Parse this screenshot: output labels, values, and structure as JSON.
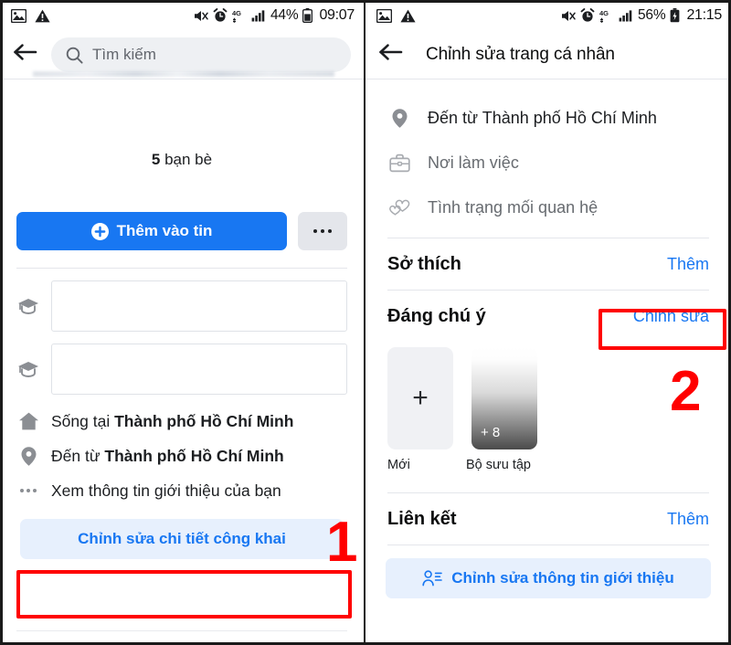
{
  "left_panel": {
    "statusbar": {
      "icons_left": [
        "image-icon",
        "warning-triangle-icon"
      ],
      "icons_right": [
        "mute-icon",
        "alarm-icon",
        "network-4g-icon",
        "signal-bars-icon"
      ],
      "network_label": "4G",
      "battery_pct": "44%",
      "clock": "09:07"
    },
    "topbar": {
      "back_icon": "back-arrow-icon",
      "search_icon": "search-icon",
      "search_placeholder": "Tìm kiếm",
      "search_value": ""
    },
    "friends": {
      "count": "5",
      "label": " bạn bè"
    },
    "actions": {
      "add_story_label": "Thêm vào tin",
      "add_story_icon": "plus-circle-icon",
      "more_icon": "more-horizontal-icon"
    },
    "fields": [
      {
        "icon": "graduation-cap-icon",
        "value": ""
      },
      {
        "icon": "graduation-cap-icon",
        "value": ""
      }
    ],
    "info_rows": [
      {
        "icon": "home-icon",
        "prefix": "Sống tại ",
        "bold": "Thành phố Hồ Chí Minh"
      },
      {
        "icon": "location-pin-icon",
        "prefix": "Đến từ ",
        "bold": "Thành phố Hồ Chí Minh"
      },
      {
        "icon": "more-horizontal-icon",
        "prefix": "Xem thông tin giới thiệu của bạn",
        "bold": ""
      }
    ],
    "edit_public_details_label": "Chỉnh sửa chi tiết công khai",
    "annotation": "1"
  },
  "right_panel": {
    "statusbar": {
      "icons_left": [
        "image-icon",
        "warning-triangle-icon"
      ],
      "icons_right": [
        "mute-icon",
        "alarm-icon",
        "network-4g-icon",
        "signal-bars-icon"
      ],
      "network_label": "4G",
      "battery_pct": "56%",
      "clock": "21:15"
    },
    "topbar": {
      "back_icon": "back-arrow-icon",
      "title": "Chỉnh sửa trang cá nhân"
    },
    "info_rows": [
      {
        "icon": "location-pin-icon",
        "text": "Đến từ Thành phố Hồ Chí Minh",
        "muted": false
      },
      {
        "icon": "briefcase-icon",
        "text": "Nơi làm việc",
        "muted": true
      },
      {
        "icon": "double-heart-icon",
        "text": "Tình trạng mối quan hệ",
        "muted": true
      }
    ],
    "sections": [
      {
        "title": "Sở thích",
        "action": "Thêm"
      },
      {
        "title": "Đáng chú ý",
        "action": "Chỉnh sửa"
      },
      {
        "title": "Liên kết",
        "action": "Thêm"
      }
    ],
    "featured_cards": [
      {
        "type": "new",
        "plus": "+",
        "caption": "Mới"
      },
      {
        "type": "collection",
        "badge": "+ 8",
        "caption": "Bộ sưu tập"
      }
    ],
    "edit_about_label": "Chỉnh sửa thông tin giới thiệu",
    "edit_about_icon": "person-details-icon",
    "annotation": "2"
  },
  "colors": {
    "accent_blue": "#1877f2",
    "annotation_red": "#ff0000",
    "light_blue_bg": "#e7f0fd",
    "grey_bg": "#e4e6eb"
  }
}
